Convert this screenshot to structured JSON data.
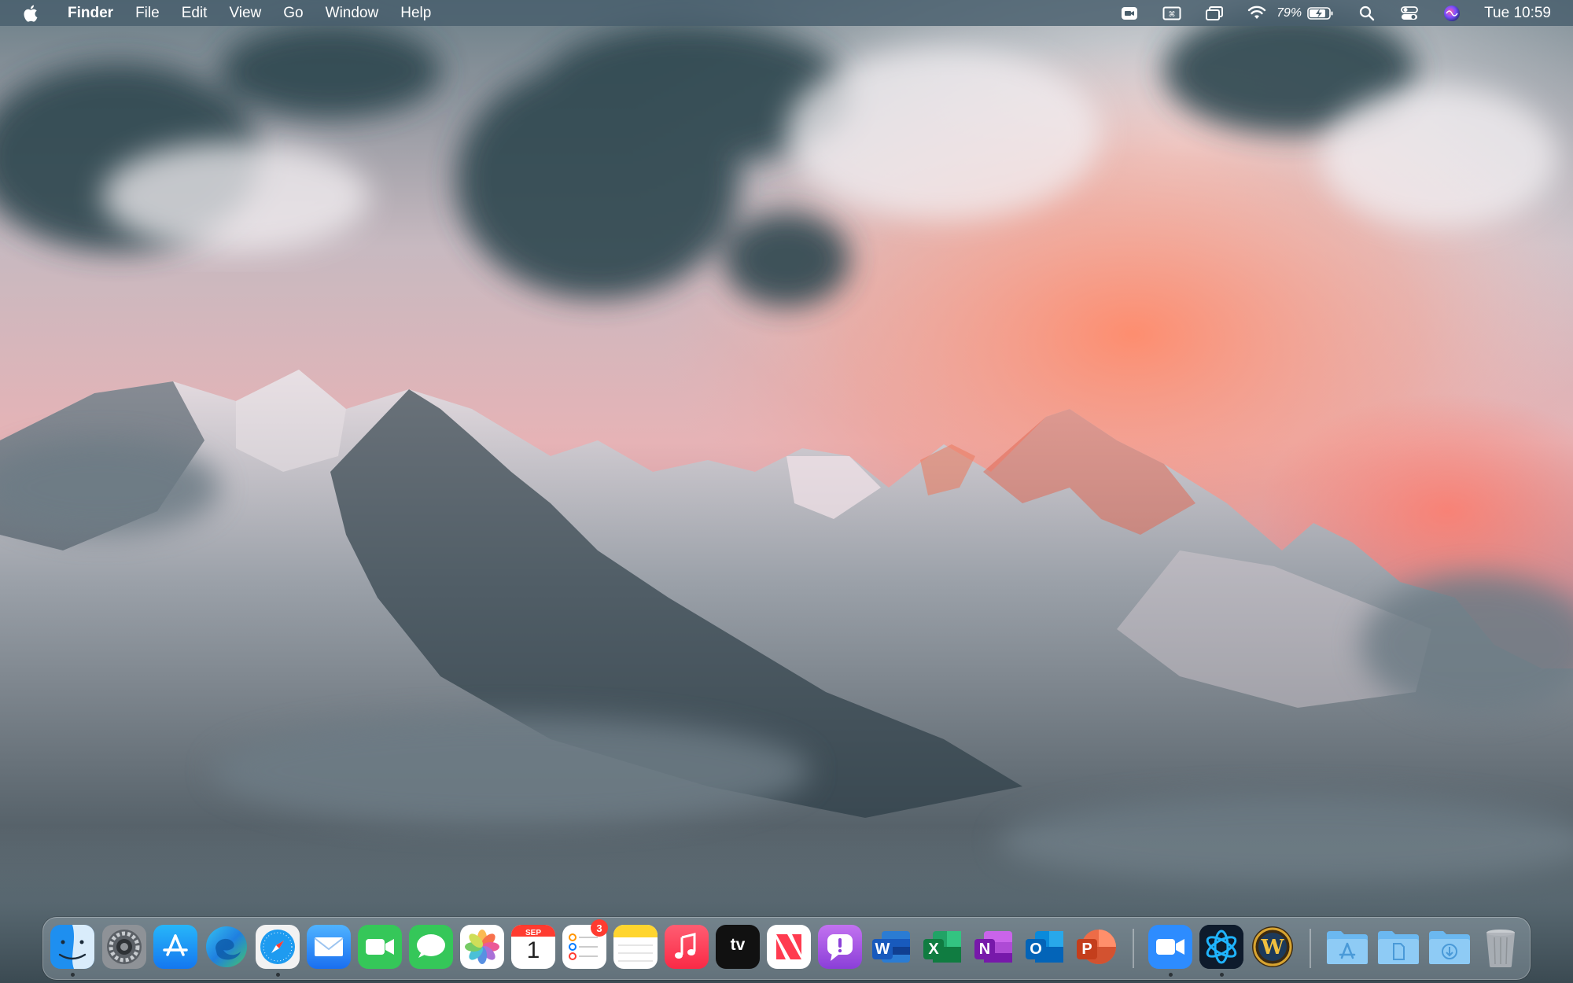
{
  "menubar": {
    "app_name": "Finder",
    "menus": [
      "File",
      "Edit",
      "View",
      "Go",
      "Window",
      "Help"
    ],
    "battery_percent": "79%",
    "clock": "Tue 10:59",
    "status_icons": [
      "video-record-icon",
      "keyboard-viewer-icon",
      "screen-mirroring-icon",
      "wifi-icon",
      "battery-charging-icon",
      "spotlight-search-icon",
      "control-center-icon",
      "siri-icon"
    ]
  },
  "dock": {
    "apps": [
      "finder",
      "system-preferences",
      "app-store",
      "edge",
      "safari",
      "mail",
      "facetime",
      "messages",
      "photos",
      "calendar",
      "reminders",
      "notes",
      "music",
      "apple-tv",
      "news",
      "feedback-assistant",
      "word",
      "excel",
      "onenote",
      "outlook",
      "powerpoint",
      "zoom",
      "battlenet",
      "world-of-warcraft",
      "applications-folder",
      "documents-folder",
      "downloads-folder",
      "trash"
    ],
    "running": [
      "finder",
      "safari",
      "zoom",
      "battlenet"
    ],
    "calendar": {
      "month": "SEP",
      "day": "1"
    },
    "reminders_badge": "3",
    "tv_label": "tv",
    "letters": {
      "word": "W",
      "excel": "X",
      "onenote": "N",
      "outlook": "O",
      "powerpoint": "P",
      "wow": "W"
    }
  },
  "colors": {
    "menubar_bg": "#485e6c",
    "badge": "#ff3b30"
  }
}
